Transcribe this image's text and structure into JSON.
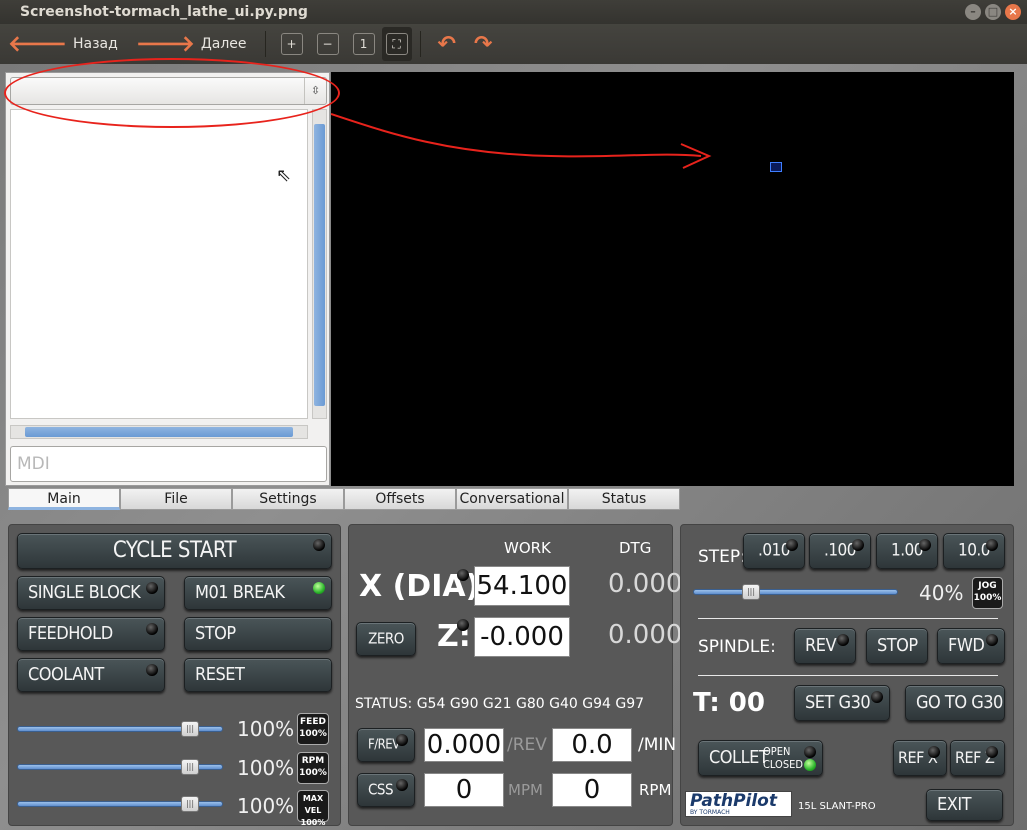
{
  "window": {
    "title": "Screenshot-tormach_lathe_ui.py.png",
    "close": "×"
  },
  "toolbar": {
    "back": "Назад",
    "forward": "Далее"
  },
  "file_panel": {
    "mdi_placeholder": "MDI"
  },
  "tabs": [
    "Main",
    "File",
    "Settings",
    "Offsets",
    "Conversational",
    "Status"
  ],
  "controls": {
    "cycle_start": "CYCLE START",
    "single_block": "SINGLE BLOCK",
    "m01_break": "M01 BREAK",
    "feedhold": "FEEDHOLD",
    "stop": "STOP",
    "coolant": "COOLANT",
    "reset": "RESET",
    "overrides": [
      {
        "pct": "100%",
        "tag1": "FEED",
        "tag2": "100%",
        "level": 1.0
      },
      {
        "pct": "100%",
        "tag1": "RPM",
        "tag2": "100%",
        "level": 1.0
      },
      {
        "pct": "100%",
        "tag1": "MAX VEL",
        "tag2": "100%",
        "level": 1.0
      }
    ]
  },
  "dro": {
    "work_header": "WORK",
    "dtg_header": "DTG",
    "x_label": "X (DIA):",
    "x_work": "54.100",
    "x_dtg": "0.000",
    "z_label": "Z:",
    "z_work": "-0.000",
    "z_dtg": "0.000",
    "zero_button": "ZERO",
    "status_label": "STATUS:",
    "status_codes": "G54 G90 G21 G80 G40 G94 G97",
    "frev_button": "F/REV",
    "frev_value": "0.000",
    "frev_unit": "/REV",
    "min_value": "0.0",
    "min_unit": "/MIN",
    "css_button": "CSS",
    "mpm_value": "0",
    "mpm_unit": "MPM",
    "rpm_value": "0",
    "rpm_unit": "RPM"
  },
  "right": {
    "step_label": "STEP:",
    "steps": [
      ".010",
      ".100",
      "1.00",
      "10.0"
    ],
    "jog_pct": "40%",
    "jog_tag1": "JOG",
    "jog_tag2": "100%",
    "jog_level": 0.4,
    "spindle_label": "SPINDLE:",
    "rev": "REV",
    "spindle_stop": "STOP",
    "fwd": "FWD",
    "tool_label": "T: 00",
    "set_g30": "SET G30",
    "go_to_g30": "GO TO G30",
    "collet": "COLLET",
    "collet_open": "OPEN",
    "collet_closed": "CLOSED",
    "ref_x": "REF X",
    "ref_z": "REF Z",
    "logo": "PathPilot",
    "logo_sub": "BY TORMACH",
    "model": "15L SLANT-PRO",
    "exit": "EXIT"
  },
  "colors": {
    "accent": "#8fb4e0",
    "annotation": "#e8231c",
    "led_on": "#2bb52b"
  }
}
